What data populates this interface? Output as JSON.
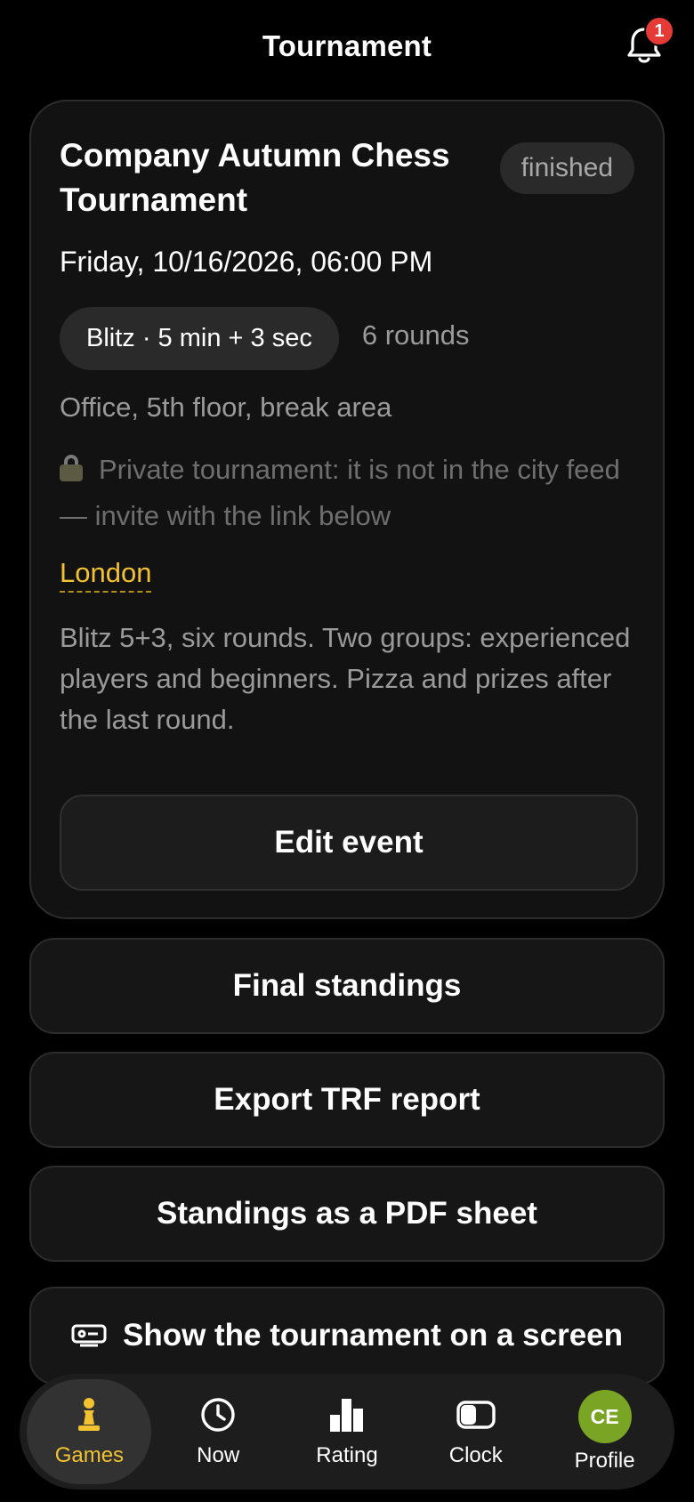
{
  "header": {
    "title": "Tournament",
    "notification_count": "1"
  },
  "event": {
    "title": "Company Autumn Chess Tournament",
    "status": "finished",
    "date": "Friday, 10/16/2026, 06:00 PM",
    "format": "Blitz · 5 min + 3 sec",
    "rounds": "6 rounds",
    "location": "Office, 5th floor, break area",
    "private_note": "Private tournament: it is not in the city feed — invite with the link below",
    "city": "London",
    "description": "Blitz 5+3, six rounds. Two groups: experienced players and beginners. Pizza and prizes after the last round.",
    "edit_label": "Edit event"
  },
  "actions": {
    "final_standings": "Final standings",
    "export_trf": "Export TRF report",
    "pdf_sheet": "Standings as a PDF sheet",
    "show_screen": "Show the tournament on a screen"
  },
  "nav": {
    "items": [
      {
        "label": "Games",
        "icon": "pawn-icon",
        "active": true
      },
      {
        "label": "Now",
        "icon": "clock-icon",
        "active": false
      },
      {
        "label": "Rating",
        "icon": "bar-chart-icon",
        "active": false
      },
      {
        "label": "Clock",
        "icon": "chess-clock-icon",
        "active": false
      },
      {
        "label": "Profile",
        "icon": "avatar",
        "active": false
      }
    ],
    "profile_initials": "CE"
  },
  "colors": {
    "accent": "#f2c230",
    "badge": "#e63a36",
    "avatar": "#7aa524"
  }
}
